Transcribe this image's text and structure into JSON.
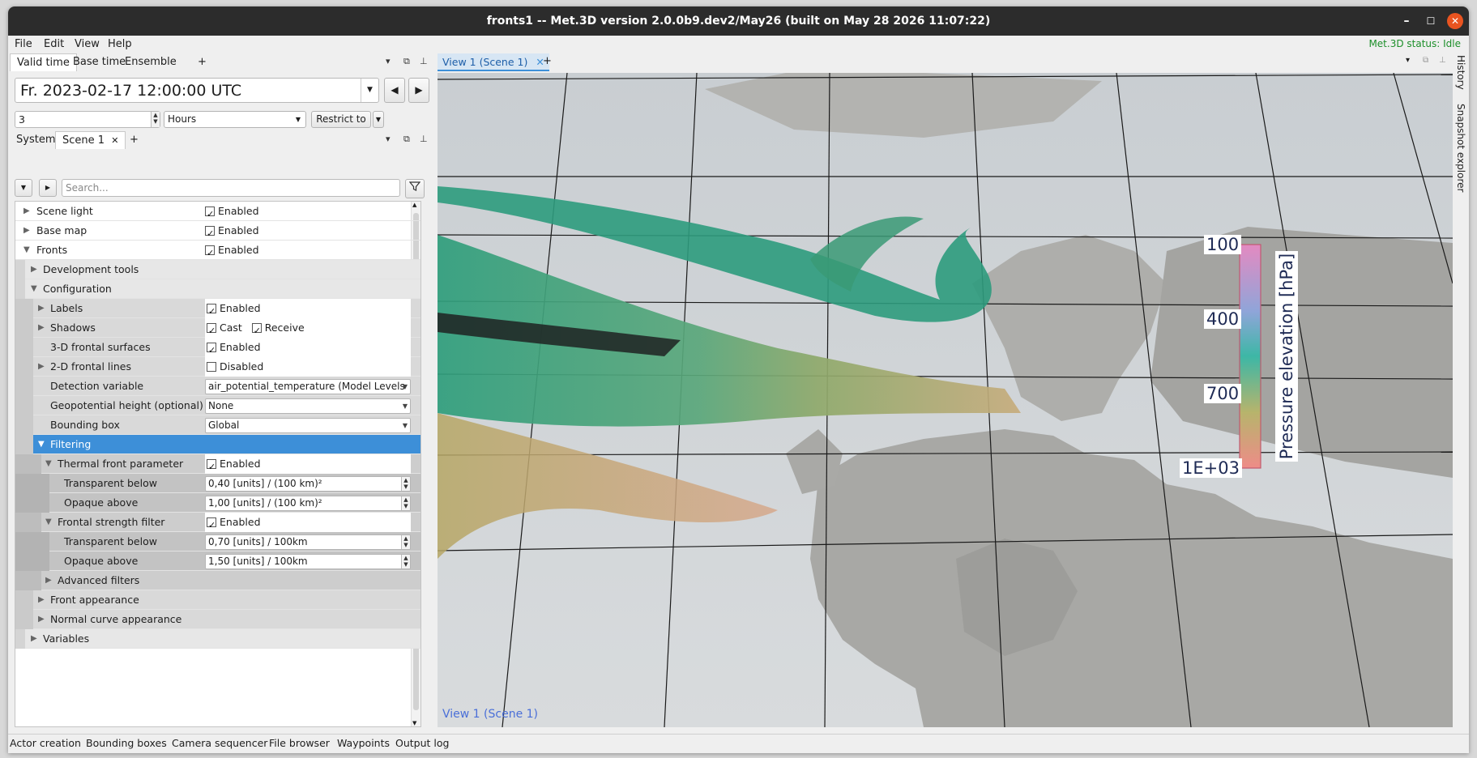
{
  "window": {
    "title": "fronts1 -- Met.3D version 2.0.0b9.dev2/May26 (built on May 28 2026 11:07:22)"
  },
  "menu": [
    "File",
    "Edit",
    "View",
    "Help"
  ],
  "status": "Met.3D status: Idle",
  "time_tabs": [
    "Valid time",
    "Base time",
    "Ensemble",
    "+"
  ],
  "time": {
    "datetime": "Fr. 2023-02-17 12:00:00 UTC",
    "step_value": "3",
    "step_unit": "Hours",
    "restrict_label": "Restrict to"
  },
  "scene_tabs": {
    "system": "System",
    "scene": "Scene 1",
    "plus": "+"
  },
  "search": {
    "placeholder": "Search..."
  },
  "tree": {
    "scene_light": {
      "label": "Scene light",
      "value": "Enabled"
    },
    "base_map": {
      "label": "Base map",
      "value": "Enabled"
    },
    "fronts": {
      "label": "Fronts",
      "value": "Enabled"
    },
    "dev_tools": {
      "label": "Development tools"
    },
    "configuration": {
      "label": "Configuration"
    },
    "labels": {
      "label": "Labels",
      "value": "Enabled"
    },
    "shadows": {
      "label": "Shadows",
      "cast": "Cast",
      "receive": "Receive"
    },
    "surfaces3d": {
      "label": "3-D frontal surfaces",
      "value": "Enabled"
    },
    "lines2d": {
      "label": "2-D frontal lines",
      "value": "Disabled"
    },
    "detection": {
      "label": "Detection variable",
      "value": "air_potential_temperature (Model Levels"
    },
    "geopotential": {
      "label": "Geopotential height (optional)",
      "value": "None"
    },
    "bbox": {
      "label": "Bounding box",
      "value": "Global"
    },
    "filtering": {
      "label": "Filtering"
    },
    "thermal": {
      "label": "Thermal front parameter",
      "value": "Enabled"
    },
    "thermal_transparent": {
      "label": "Transparent below",
      "value": "0,40 [units] / (100 km)²"
    },
    "thermal_opaque": {
      "label": "Opaque above",
      "value": "1,00 [units] / (100 km)²"
    },
    "strength": {
      "label": "Frontal strength filter",
      "value": "Enabled"
    },
    "strength_transparent": {
      "label": "Transparent below",
      "value": "0,70 [units] / 100km"
    },
    "strength_opaque": {
      "label": "Opaque above",
      "value": "1,50 [units] / 100km"
    },
    "advanced": {
      "label": "Advanced filters"
    },
    "appearance": {
      "label": "Front appearance"
    },
    "normal_curve": {
      "label": "Normal curve appearance"
    },
    "variables": {
      "label": "Variables"
    }
  },
  "view": {
    "tab": "View 1 (Scene 1)",
    "plus": "+",
    "overlay_label": "View 1 (Scene 1)",
    "colorbar": {
      "title": "Pressure elevation [hPa]",
      "ticks": [
        "100",
        "400",
        "700",
        "1E+03"
      ]
    }
  },
  "right_tabs": [
    "History",
    "Snapshot explorer"
  ],
  "bottom_tabs": [
    "Actor creation",
    "Bounding boxes",
    "Camera sequencer",
    "File browser",
    "Waypoints",
    "Output log"
  ],
  "colors": {
    "accent": "#3d8fd8",
    "status": "#1d8f2a",
    "close": "#e95420"
  }
}
